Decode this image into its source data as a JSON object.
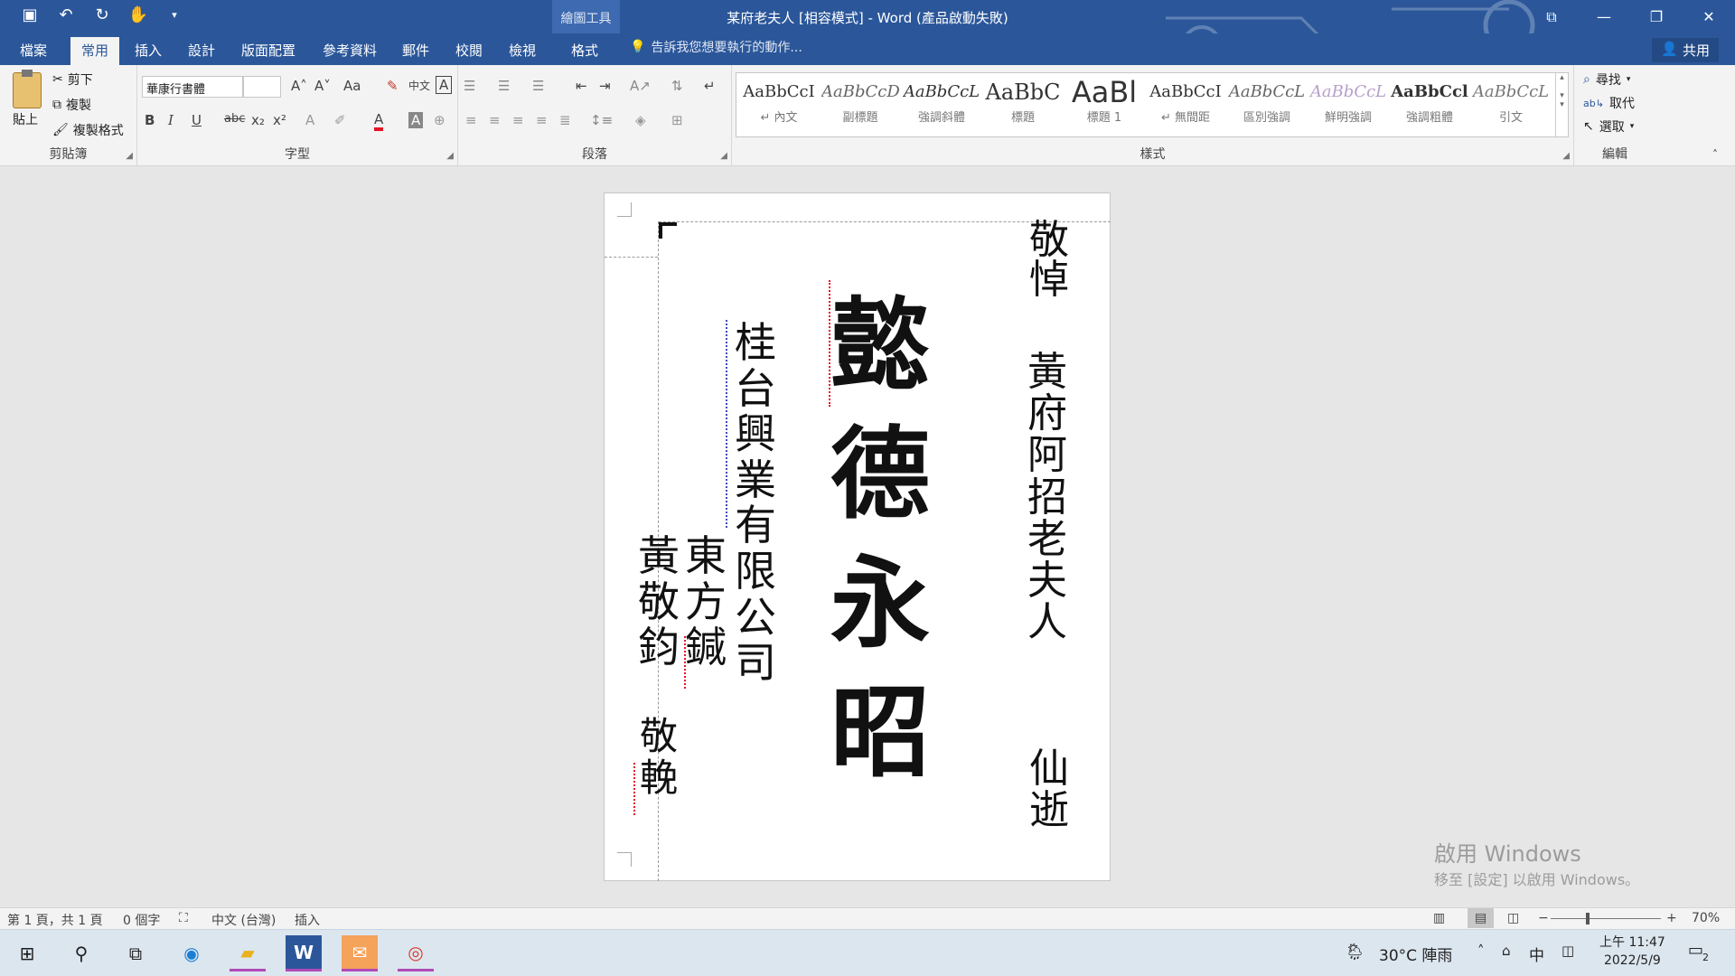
{
  "titlebar": {
    "title": "某府老夫人 [相容模式] - Word (產品啟動失敗)",
    "context_group": "繪圖工具",
    "qat_icons": [
      "save-icon",
      "undo-icon",
      "redo-icon",
      "touch-mode-icon",
      "customize-icon"
    ]
  },
  "tabs": [
    {
      "label": "檔案"
    },
    {
      "label": "常用"
    },
    {
      "label": "插入"
    },
    {
      "label": "設計"
    },
    {
      "label": "版面配置"
    },
    {
      "label": "參考資料"
    },
    {
      "label": "郵件"
    },
    {
      "label": "校閱"
    },
    {
      "label": "檢視"
    },
    {
      "label": "格式"
    }
  ],
  "active_tab": "常用",
  "tellme": "告訴我您想要執行的動作...",
  "share": "共用",
  "clipboard": {
    "paste": "貼上",
    "cut": "剪下",
    "copy": "複製",
    "format_painter": "複製格式",
    "group": "剪貼簿"
  },
  "font": {
    "name": "華康行書體",
    "size": "",
    "group": "字型",
    "change_case": "Aa",
    "phonetic": "中文"
  },
  "paragraph": {
    "group": "段落"
  },
  "styles": {
    "group": "樣式",
    "items": [
      {
        "sample": "AaBbCcI",
        "name": "↵ 內文"
      },
      {
        "sample": "AaBbCcD",
        "name": "副標題"
      },
      {
        "sample": "AaBbCcL",
        "name": "強調斜體"
      },
      {
        "sample": "AaBbC",
        "name": "標題"
      },
      {
        "sample": "AaBl",
        "name": "標題 1"
      },
      {
        "sample": "AaBbCcI",
        "name": "↵ 無間距"
      },
      {
        "sample": "AaBbCcL",
        "name": "區別強調"
      },
      {
        "sample": "AaBbCcL",
        "name": "鮮明強調"
      },
      {
        "sample": "AaBbCcl",
        "name": "強調粗體"
      },
      {
        "sample": "AaBbCcL",
        "name": "引文"
      }
    ]
  },
  "editing": {
    "group": "編輯",
    "find": "尋找",
    "replace": "取代",
    "select": "選取"
  },
  "document": {
    "col1": "敬悼",
    "col2": "黃府阿招老夫人",
    "col3": "仙逝",
    "main": "懿德永昭",
    "company": "桂台興業有限公司",
    "person1": "東方鍼",
    "person2": "黃敬鈞",
    "closing": "敬輓"
  },
  "status": {
    "page": "第 1 頁，共 1 頁",
    "words": "0 個字",
    "lang": "中文 (台灣)",
    "mode": "插入",
    "zoom": "70%",
    "zoom_level": 70
  },
  "activation": {
    "line1": "啟用 Windows",
    "line2": "移至 [設定] 以啟用 Windows。"
  },
  "taskbar": {
    "weather": "30°C  陣雨",
    "ime": "中",
    "time": "上午 11:47",
    "date": "2022/5/9",
    "notifications": "2"
  },
  "colors": {
    "word_blue": "#2b579a",
    "font_color": "#e81123"
  }
}
